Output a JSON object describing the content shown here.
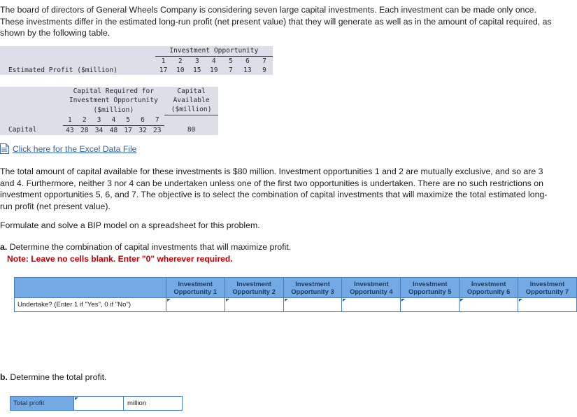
{
  "intro": {
    "paragraph": "The board of directors of General Wheels Company is considering seven large capital investments. Each investment can be made only once. These investments differ in the estimated long-run profit (net present value) that they will generate as well as in the amount of capital required, as shown by the following table."
  },
  "profit_table": {
    "group_header": "Investment Opportunity",
    "columns": [
      "1",
      "2",
      "3",
      "4",
      "5",
      "6",
      "7"
    ],
    "row_label": "Estimated Profit ($million)",
    "values": [
      "17",
      "10",
      "15",
      "19",
      "7",
      "13",
      "9"
    ]
  },
  "capital_table": {
    "group_header_line1": "Capital Required for",
    "group_header_line2": "Investment Opportunity",
    "group_header_line3": "($million)",
    "available_header_line1": "Capital",
    "available_header_line2": "Available",
    "available_header_line3": "($million)",
    "columns": [
      "1",
      "2",
      "3",
      "4",
      "5",
      "6",
      "7"
    ],
    "row_label": "Capital",
    "values": [
      "43",
      "28",
      "34",
      "48",
      "17",
      "32",
      "23"
    ],
    "available_value": "80"
  },
  "excel_link": {
    "icon": "excel-file-icon",
    "label": "Click here for the Excel Data File"
  },
  "body": {
    "restrictions": "The total amount of capital available for these investments is $80 million. Investment opportunities 1 and 2 are mutually exclusive, and so are 3 and 4. Furthermore, neither 3 nor 4 can be undertaken unless one of the first two opportunities is undertaken. There are no such restrictions on investment opportunities 5, 6, and 7. The objective is to select the combination of capital investments that will maximize the total estimated long-run profit (net present value).",
    "formulate": "Formulate and solve a BIP model on a spreadsheet for this problem."
  },
  "question_a": {
    "label": "a.",
    "text": "Determine the combination of capital investments that will maximize profit.",
    "note": "Note: Leave no cells blank. Enter \"0\" wherever required."
  },
  "answer_grid": {
    "corner_header": "",
    "column_headers": [
      "Investment Opportunity 1",
      "Investment Opportunity 2",
      "Investment Opportunity 3",
      "Investment Opportunity 4",
      "Investment Opportunity 5",
      "Investment Opportunity 6",
      "Investment Opportunity 7"
    ],
    "row_label": "Undertake? (Enter 1 if \"Yes\", 0 if \"No\")",
    "row_values": [
      "",
      "",
      "",
      "",
      "",
      "",
      ""
    ]
  },
  "question_b": {
    "label": "b.",
    "text": "Determine the total profit."
  },
  "total_grid": {
    "label": "Total profit",
    "value": "",
    "unit": "million"
  },
  "colors": {
    "header_blue": "#74aae4",
    "grid_border": "#4a7ebb",
    "data_table_bg": "#dcdfe8",
    "link_blue": "#31639c",
    "note_red": "#c00000"
  }
}
